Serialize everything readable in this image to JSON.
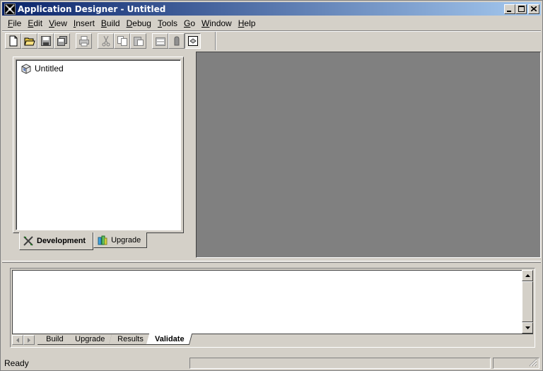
{
  "window": {
    "title": "Application Designer - Untitled",
    "minimize_label": "_",
    "maximize_label": "□",
    "close_label": "✕"
  },
  "menu": [
    {
      "ul": "F",
      "rest": "ile"
    },
    {
      "ul": "E",
      "rest": "dit"
    },
    {
      "ul": "V",
      "rest": "iew"
    },
    {
      "ul": "I",
      "rest": "nsert"
    },
    {
      "ul": "B",
      "rest": "uild"
    },
    {
      "ul": "D",
      "rest": "ebug"
    },
    {
      "ul": "T",
      "rest": "ools"
    },
    {
      "ul": "G",
      "rest": "o"
    },
    {
      "ul": "W",
      "rest": "indow"
    },
    {
      "ul": "H",
      "rest": "elp"
    }
  ],
  "toolbar": {
    "icons": [
      "new-icon",
      "open-icon",
      "save-icon",
      "save-all-icon",
      "print-icon",
      "cut-icon",
      "copy-icon",
      "paste-icon",
      "properties-icon",
      "upgrade-icon",
      "toggle-project-icon"
    ]
  },
  "project": {
    "root_label": "Untitled",
    "tabs": [
      {
        "label": "Development",
        "active": true
      },
      {
        "label": "Upgrade",
        "active": false
      }
    ]
  },
  "output": {
    "tabs": [
      {
        "label": "Build",
        "active": false
      },
      {
        "label": "Upgrade",
        "active": false
      },
      {
        "label": "Results",
        "active": false
      },
      {
        "label": "Validate",
        "active": true
      }
    ]
  },
  "status": {
    "text": "Ready"
  },
  "colors": {
    "title_start": "#0a246a",
    "title_end": "#a6caf0",
    "face": "#d4d0c8",
    "workspace": "#808080"
  }
}
